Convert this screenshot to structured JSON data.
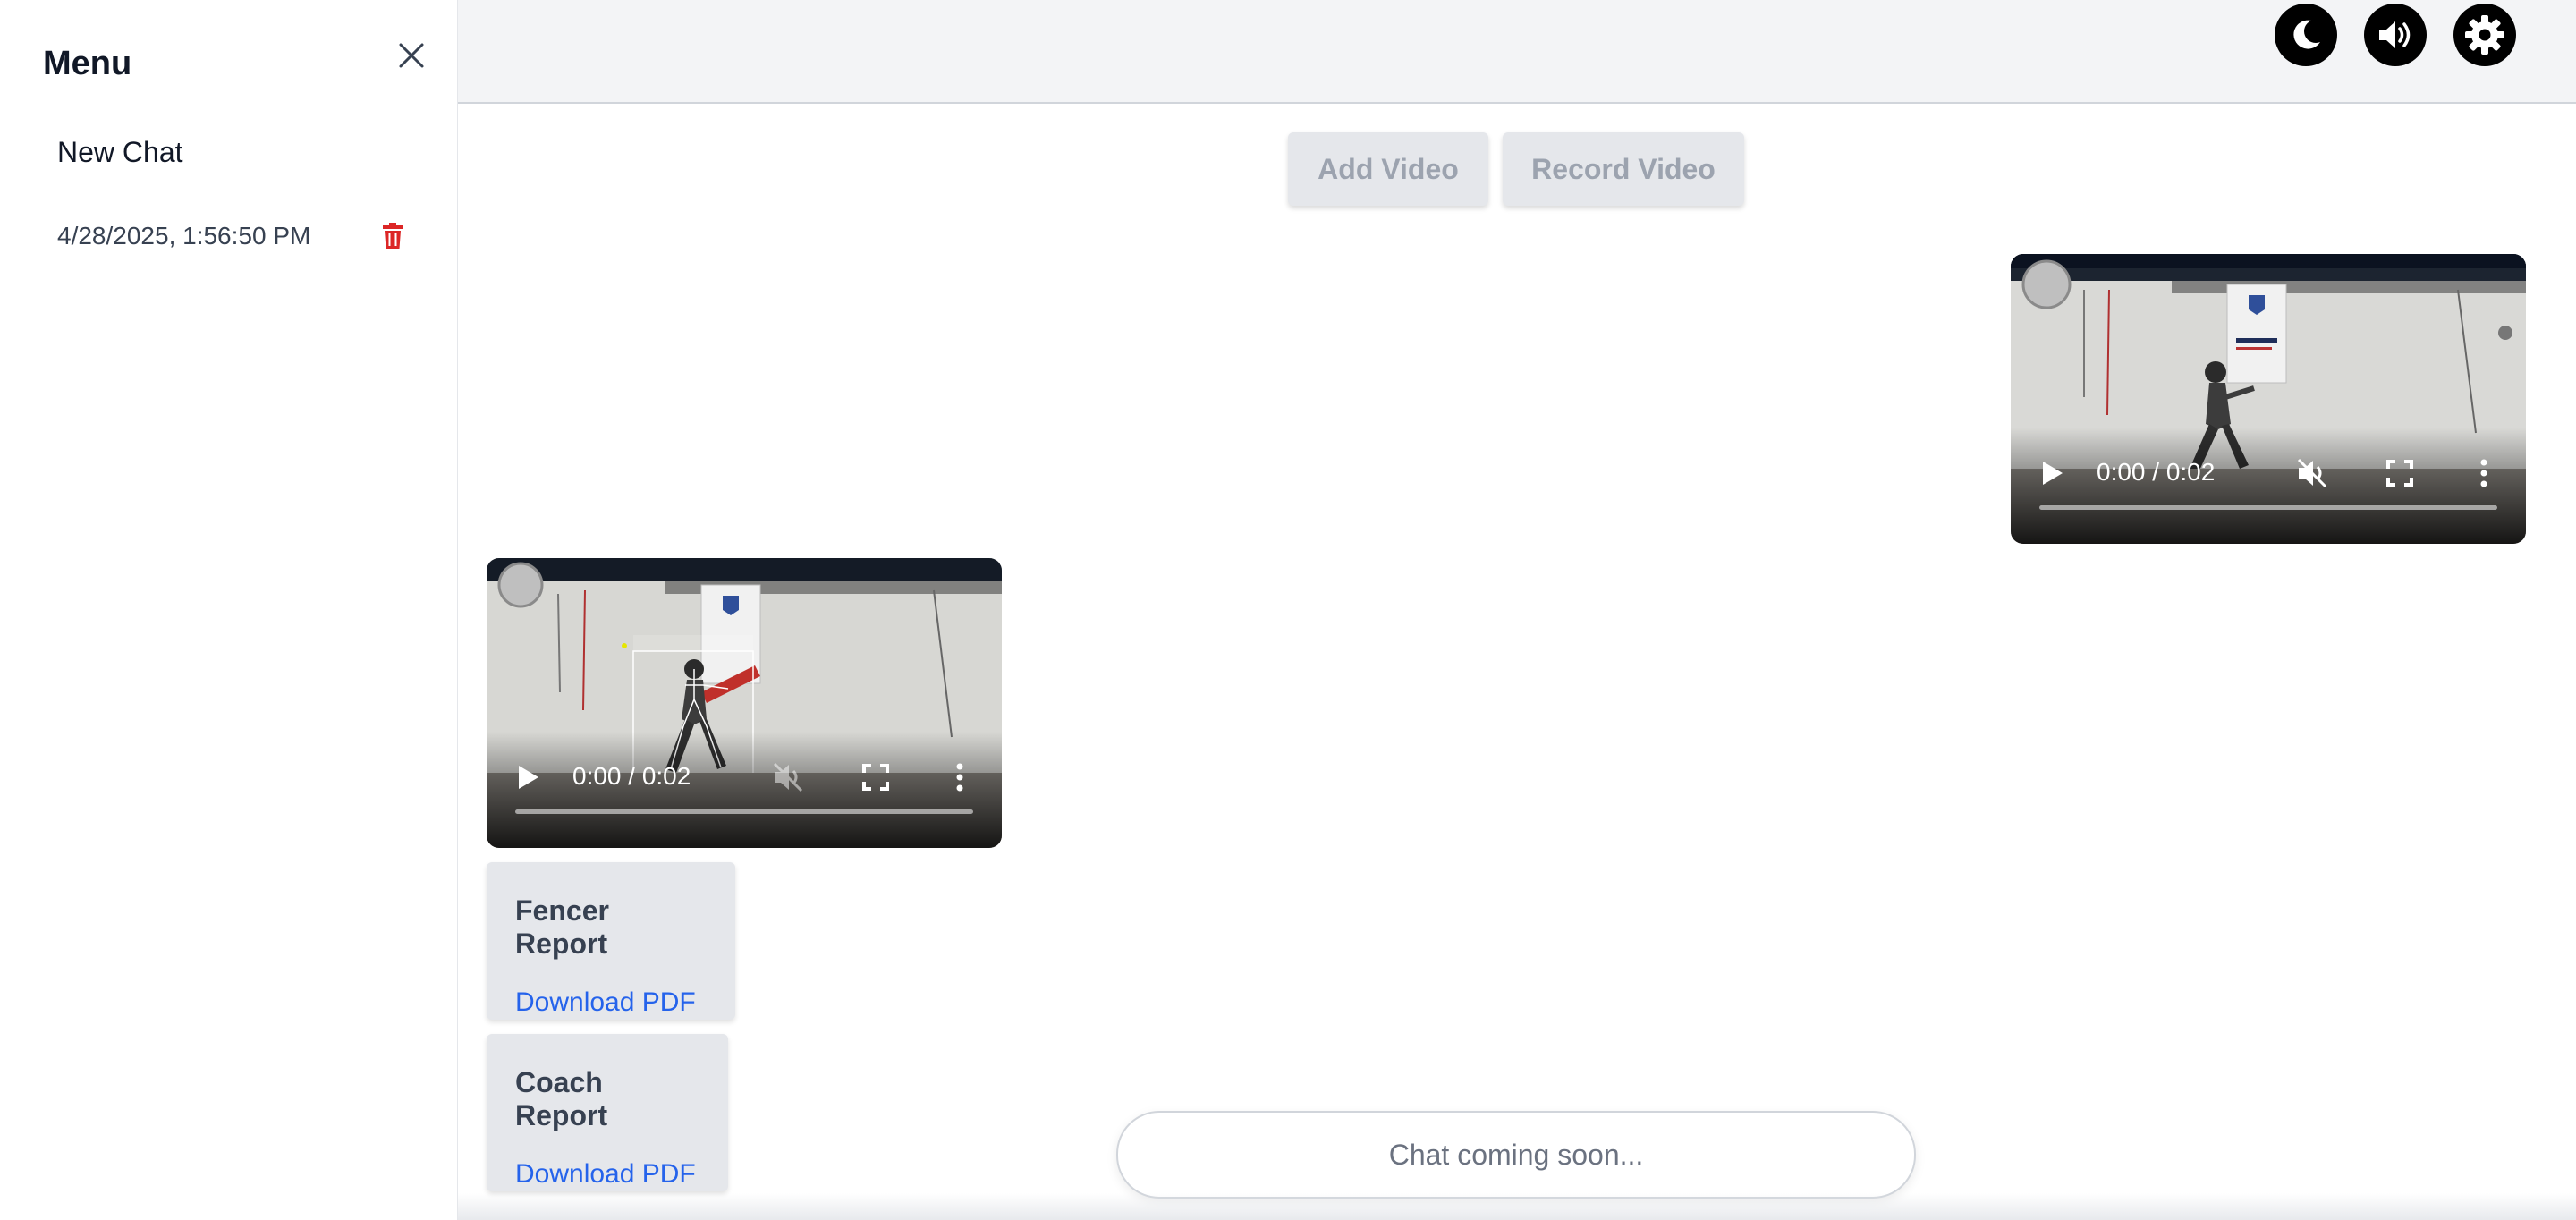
{
  "sidebar": {
    "title": "Menu",
    "new_chat_label": "New Chat",
    "history": [
      {
        "label": "4/28/2025, 1:56:50 PM"
      }
    ]
  },
  "header": {
    "icons": [
      "moon-icon",
      "volume-icon",
      "gear-icon"
    ]
  },
  "toolbar": {
    "add_video_label": "Add Video",
    "record_video_label": "Record Video"
  },
  "videos": [
    {
      "time": "0:00 / 0:02"
    },
    {
      "time": "0:00 / 0:02"
    }
  ],
  "reports": [
    {
      "title": "Fencer Report",
      "link": "Download PDF"
    },
    {
      "title": "Coach Report",
      "link": "Download PDF"
    }
  ],
  "chat": {
    "placeholder": "Chat coming soon..."
  },
  "colors": {
    "accent_link": "#2563eb",
    "danger": "#dc2626",
    "header_bg": "#f3f4f6",
    "button_bg": "#e5e7eb"
  }
}
